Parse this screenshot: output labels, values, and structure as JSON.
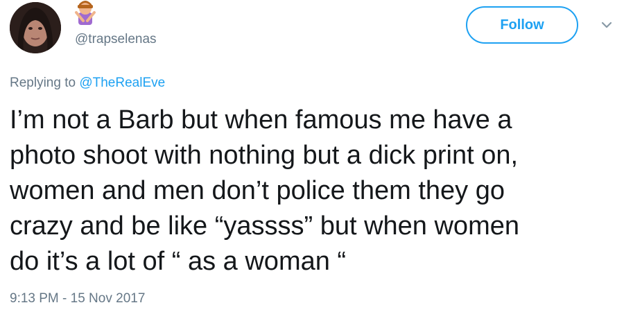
{
  "user": {
    "handle": "@trapselenas",
    "avatar_icon": "profile-photo",
    "name_emoji_icon": "person-gesturing-no-emoji"
  },
  "actions": {
    "follow_label": "Follow",
    "more_icon": "chevron-down-icon"
  },
  "reply": {
    "prefix": "Replying to",
    "mention": "@TheRealEve"
  },
  "tweet": {
    "lines": [
      "I’m not a Barb but when famous me have a",
      "photo shoot with nothing but a dick print on,",
      "women and men don’t police them they go",
      "crazy and be like “yassss” but when women",
      "do it’s a lot of “ as a woman “"
    ]
  },
  "timestamp": "9:13 PM - 15 Nov 2017",
  "colors": {
    "accent": "#1da1f2",
    "secondary_text": "#657786",
    "primary_text": "#14171a"
  }
}
